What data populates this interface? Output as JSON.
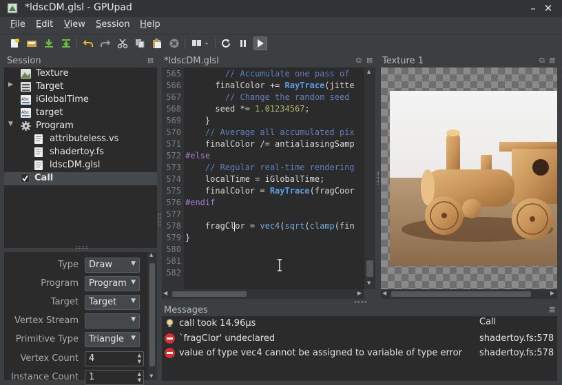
{
  "window": {
    "title": "*ldscDM.glsl - GPUpad",
    "minimize": "–",
    "close": "✕"
  },
  "menu": [
    {
      "label": "File",
      "u": "F",
      "rest": "ile"
    },
    {
      "label": "Edit",
      "u": "E",
      "rest": "dit"
    },
    {
      "label": "View",
      "u": "V",
      "rest": "iew"
    },
    {
      "label": "Session",
      "u": "S",
      "rest": "ession"
    },
    {
      "label": "Help",
      "u": "H",
      "rest": "elp"
    }
  ],
  "toolbar": {
    "icons": [
      "new-file-icon",
      "open-icon",
      "save-icon",
      "save-all-icon",
      "undo-icon",
      "redo-icon",
      "cut-icon",
      "copy-icon",
      "paste-icon",
      "delete-icon",
      "find-icon",
      "reload-icon",
      "pause-icon",
      "run-icon"
    ]
  },
  "session": {
    "title": "Session",
    "items": [
      {
        "label": "Texture",
        "icon": "texture-icon"
      },
      {
        "label": "Target",
        "icon": "target-icon"
      },
      {
        "label": "iGlobalTime",
        "icon": "uniform-icon"
      },
      {
        "label": "target",
        "icon": "uniform-icon"
      },
      {
        "label": "Program",
        "icon": "gear-icon"
      },
      {
        "label": "attributeless.vs",
        "icon": "file-icon"
      },
      {
        "label": "shadertoy.fs",
        "icon": "file-icon"
      },
      {
        "label": "ldscDM.glsl",
        "icon": "file-icon"
      },
      {
        "label": "Call",
        "icon": "check-icon"
      }
    ]
  },
  "properties": {
    "type": {
      "label": "Type",
      "value": "Draw"
    },
    "program": {
      "label": "Program",
      "value": "Program"
    },
    "target": {
      "label": "Target",
      "value": "Target"
    },
    "vertex_stream": {
      "label": "Vertex Stream",
      "value": ""
    },
    "primitive_type": {
      "label": "Primitive Type",
      "value": "Triangle"
    },
    "vertex_count": {
      "label": "Vertex Count",
      "value": "4"
    },
    "instance_count": {
      "label": "Instance Count",
      "value": "1"
    }
  },
  "editor": {
    "tab": "*ldscDM.glsl",
    "lines": [
      {
        "n": "565",
        "code": [
          [
            "c-com",
            "        // Accumulate one pass of"
          ]
        ]
      },
      {
        "n": "566",
        "code": [
          [
            "",
            "      finalColor += "
          ],
          [
            "c-fn",
            "RayTrace"
          ],
          [
            "",
            "(jitte"
          ]
        ]
      },
      {
        "n": "567",
        "code": [
          [
            "c-com",
            "        // Change the random seed"
          ]
        ]
      },
      {
        "n": "568",
        "code": [
          [
            "",
            "      seed *= "
          ],
          [
            "c-num",
            "1.01234567"
          ],
          [
            "",
            ";"
          ]
        ]
      },
      {
        "n": "569",
        "code": [
          [
            "",
            "    }"
          ]
        ]
      },
      {
        "n": "570",
        "code": [
          [
            "c-com",
            "    // Average all accumulated pix"
          ]
        ]
      },
      {
        "n": "571",
        "code": [
          [
            "",
            "    finalColor /= antialiasingSamp"
          ]
        ]
      },
      {
        "n": "572",
        "code": [
          [
            "c-pre",
            "#else"
          ]
        ]
      },
      {
        "n": "573",
        "code": [
          [
            "c-com",
            "    // Regular real-time rendering"
          ]
        ]
      },
      {
        "n": "574",
        "code": [
          [
            "",
            "    localTime = iGlobalTime;"
          ]
        ]
      },
      {
        "n": "575",
        "code": [
          [
            "",
            "    finalColor = "
          ],
          [
            "c-fn",
            "RayTrace"
          ],
          [
            "",
            "(fragCoor"
          ]
        ]
      },
      {
        "n": "576",
        "code": [
          [
            "c-pre",
            "#endif"
          ]
        ]
      },
      {
        "n": "577",
        "code": [
          [
            "",
            ""
          ]
        ]
      },
      {
        "n": "578",
        "code": [
          [
            "",
            "    fragClor = "
          ],
          [
            "c-bi",
            "vec4"
          ],
          [
            "",
            "("
          ],
          [
            "c-bi",
            "sqrt"
          ],
          [
            "",
            "("
          ],
          [
            "c-bi",
            "clamp"
          ],
          [
            "",
            "(fin"
          ]
        ]
      },
      {
        "n": "579",
        "code": [
          [
            "",
            "}"
          ]
        ]
      },
      {
        "n": "580",
        "code": [
          [
            "",
            ""
          ]
        ]
      },
      {
        "n": "581",
        "code": [
          [
            "",
            ""
          ]
        ]
      },
      {
        "n": "582",
        "code": [
          [
            "",
            ""
          ]
        ]
      }
    ]
  },
  "texture": {
    "tab": "Texture 1"
  },
  "messages": {
    "title": "Messages",
    "items": [
      {
        "icon": "info-bulb-icon",
        "text": "call took 14.96µs",
        "source": "Call",
        "color": "#d8c060"
      },
      {
        "icon": "error-icon",
        "text": "`fragClor' undeclared",
        "source": "shadertoy.fs:578",
        "color": "#d83030"
      },
      {
        "icon": "error-icon",
        "text": "value of type vec4 cannot be assigned to variable of type error",
        "source": "shadertoy.fs:578",
        "color": "#d83030"
      }
    ]
  },
  "colors": {
    "background": "#3c3f41",
    "panel": "#2b2b2b",
    "accent": "#5aa0e6",
    "error": "#d83030"
  }
}
